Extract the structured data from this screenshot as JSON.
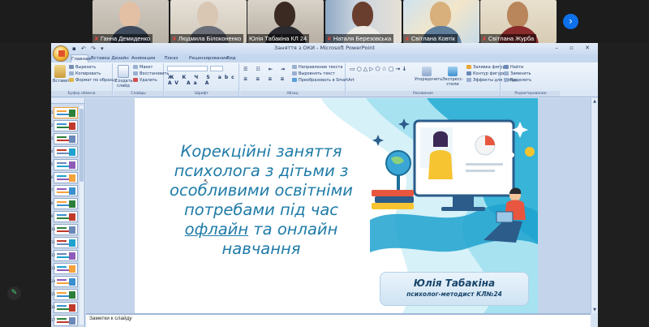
{
  "participants": [
    {
      "name": "Ганна Демиденко",
      "muted": true
    },
    {
      "name": "Людмила Білоконенко",
      "muted": true
    },
    {
      "name": "Юлія Табакіна КЛ 24",
      "muted": false
    },
    {
      "name": "Наталя Березовська",
      "muted": true
    },
    {
      "name": "Світлана Ковтік",
      "muted": true
    },
    {
      "name": "Світлана Журба",
      "muted": true
    }
  ],
  "next_arrow": "›",
  "ppt": {
    "window_title": "Заняття з ОКИ - Microsoft PowerPoint",
    "qat": "▪ ↶ ↷ ▾",
    "window_controls": "– ▫ ✕",
    "tabs": [
      "Главная",
      "Вставка",
      "Дизайн",
      "Анимация",
      "Показ слайдов",
      "Рецензирование",
      "Вид"
    ],
    "ribbon": {
      "clipboard": {
        "paste": "Вставить",
        "cut": "Вырезать",
        "copy": "Копировать",
        "format": "Формат по образцу",
        "label": "Буфер обмена"
      },
      "slides": {
        "create": "Создать слайд",
        "layout": "Макет",
        "reset": "Восстановить",
        "delete": "Удалить",
        "label": "Слайды"
      },
      "font": {
        "label": "Шрифт",
        "fmt": "Ж К Ч S abc AV Aa A"
      },
      "paragraph": {
        "direction": "Направление текста",
        "align": "Выровнять текст",
        "smartart": "Преобразовать в SmartArt",
        "label": "Абзац"
      },
      "drawing": {
        "arrange": "Упорядочить",
        "styles": "Экспресс-стили",
        "fill": "Заливка фигуры",
        "outline": "Контур фигуры",
        "effects": "Эффекты для фигур",
        "label": "Рисование"
      },
      "editing": {
        "find": "Найти",
        "replace": "Заменить",
        "select": "Выделить",
        "label": "Редактирование"
      }
    },
    "slide_numbers": [
      "1",
      "2",
      "3",
      "4",
      "5",
      "6",
      "7",
      "8",
      "9",
      "10",
      "11",
      "12",
      "13",
      "14",
      "15",
      "16",
      "17"
    ],
    "slide": {
      "title_line1": "Корекційні заняття",
      "title_line2": "психолога з дітьми з",
      "title_line3": "особливими освітніми",
      "title_line4": "потребами під час",
      "title_line5_a": "офлайн",
      "title_line5_b": " та онлайн",
      "title_line6": "навчання",
      "author_name": "Юлія Табакіна",
      "author_role": "психолог-методист  КЛ№24"
    },
    "notes_label": "Заметки к слайду"
  },
  "colors": {
    "slide_title": "#1f7ba8",
    "name_text": "#17456b",
    "zoom_blue": "#0e71eb",
    "wave_light": "#6fd0e6",
    "wave_dark": "#1ea2cf"
  }
}
